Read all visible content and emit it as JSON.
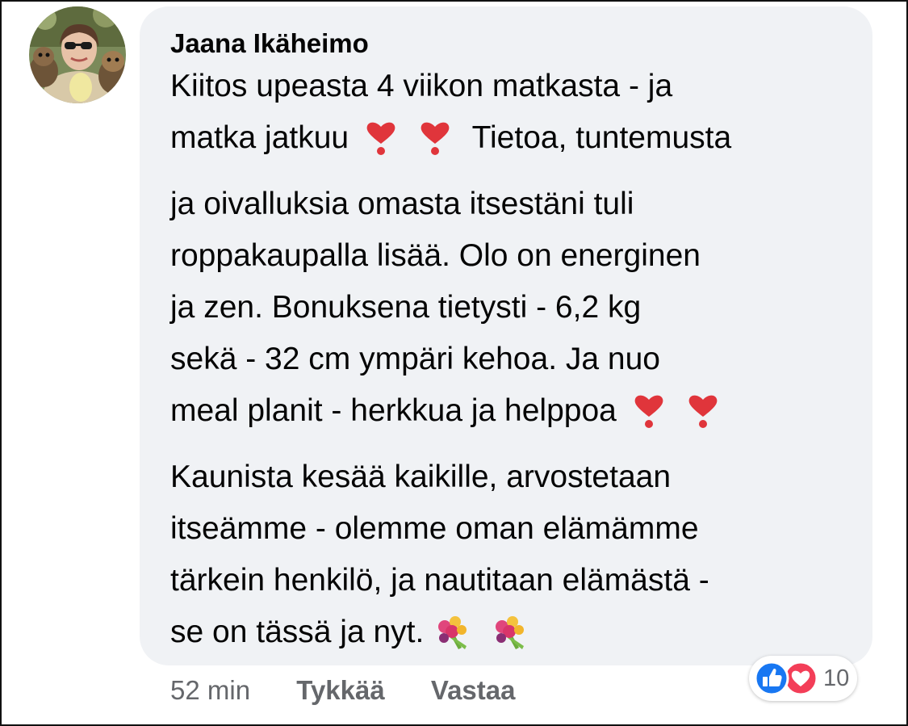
{
  "comment": {
    "author": "Jaana Ikäheimo",
    "lines": [
      "Kiitos upeasta 4 viikon matkasta - ja",
      "matka jatkuu",
      "Tietoa, tuntemusta",
      "ja oivalluksia omasta itsestäni tuli",
      "roppakaupalla lisää. Olo on energinen",
      "ja zen. Bonuksena tietysti - 6,2 kg",
      "sekä - 32 cm ympäri kehoa. Ja nuo",
      "meal planit - herkkua ja helppoa",
      "Kaunista kesää kaikille, arvostetaan",
      "itseämme - olemme oman elämämme",
      "tärkein henkilö, ja nautitaan elämästä -",
      "se on tässä ja nyt."
    ],
    "emojis": {
      "heart_exclamation": "heavy-heart-exclamation-icon",
      "bouquet": "bouquet-icon"
    }
  },
  "meta": {
    "time": "52 min",
    "like_label": "Tykkää",
    "reply_label": "Vastaa"
  },
  "reactions": {
    "count": "10",
    "types": [
      "like-icon",
      "love-icon"
    ],
    "like_color": "#1877f2",
    "love_color": "#f33e58"
  },
  "colors": {
    "bubble": "#f0f2f5",
    "text": "#050505",
    "meta_text": "#65676b"
  }
}
